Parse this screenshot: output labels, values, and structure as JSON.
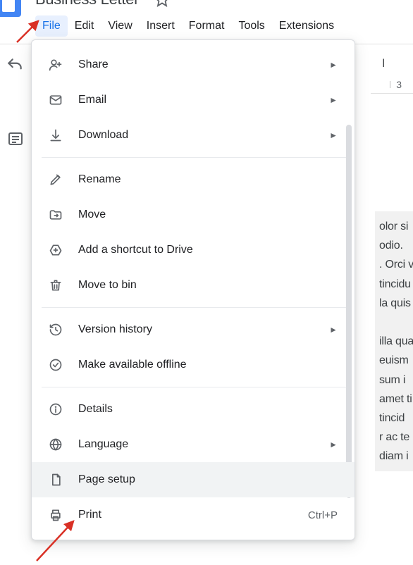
{
  "document": {
    "title": "Business Letter"
  },
  "menubar": {
    "items": [
      {
        "label": "File",
        "active": true
      },
      {
        "label": "Edit"
      },
      {
        "label": "View"
      },
      {
        "label": "Insert"
      },
      {
        "label": "Format"
      },
      {
        "label": "Tools"
      },
      {
        "label": "Extensions"
      }
    ]
  },
  "ruler": {
    "tick": "3"
  },
  "toolbar_style": {
    "label": "l"
  },
  "dropdown": {
    "groups": [
      [
        {
          "icon": "share-icon",
          "label": "Share",
          "submenu": true
        },
        {
          "icon": "email-icon",
          "label": "Email",
          "submenu": true
        },
        {
          "icon": "download-icon",
          "label": "Download",
          "submenu": true
        }
      ],
      [
        {
          "icon": "rename-icon",
          "label": "Rename"
        },
        {
          "icon": "move-icon",
          "label": "Move"
        },
        {
          "icon": "add-shortcut-icon",
          "label": "Add a shortcut to Drive"
        },
        {
          "icon": "trash-icon",
          "label": "Move to bin"
        }
      ],
      [
        {
          "icon": "history-icon",
          "label": "Version history",
          "submenu": true
        },
        {
          "icon": "offline-icon",
          "label": "Make available offline"
        }
      ],
      [
        {
          "icon": "details-icon",
          "label": "Details"
        },
        {
          "icon": "language-icon",
          "label": "Language",
          "submenu": true
        },
        {
          "icon": "page-setup-icon",
          "label": "Page setup",
          "highlighted": true
        },
        {
          "icon": "print-icon",
          "label": "Print",
          "shortcut": "Ctrl+P"
        }
      ]
    ]
  },
  "doc_preview_lines": [
    "olor si",
    "odio.",
    ". Orci v",
    "tincidu",
    "la quis",
    "",
    "illa qua",
    "euism",
    "sum i",
    "amet ti",
    " tincid",
    "r ac te",
    "diam i"
  ],
  "icons_svg": {
    "share-icon": "person-plus",
    "email-icon": "mail",
    "download-icon": "download",
    "rename-icon": "pencil",
    "move-icon": "folder-arrow",
    "add-shortcut-icon": "drive-plus",
    "trash-icon": "trash",
    "history-icon": "clock-back",
    "offline-icon": "check-circle",
    "details-icon": "info",
    "language-icon": "globe",
    "page-setup-icon": "page",
    "print-icon": "printer"
  }
}
